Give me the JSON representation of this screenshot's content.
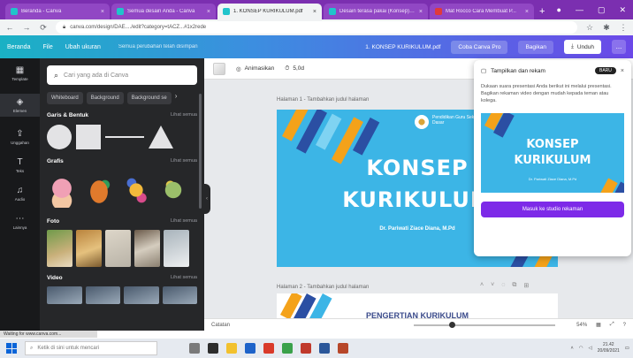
{
  "browser": {
    "tabs": [
      {
        "label": "Beranda - Canva",
        "active": false
      },
      {
        "label": "Semua desain Anda - Canva",
        "active": false
      },
      {
        "label": "1. KONSEP KURIKULUM.pdf",
        "active": true
      },
      {
        "label": "Desain terasa pakai (Konsep) - Canva",
        "active": false
      },
      {
        "label": "Mat Rocco Cara Membuat P...",
        "active": false
      }
    ],
    "url": "canva.com/design/DAE..../edit?category=tACZ...#1x2rede"
  },
  "canva_header": {
    "home": "Beranda",
    "file": "File",
    "resize": "Ubah ukuran",
    "saved_status": "Semua perubahan telah disimpan",
    "doc_title": "1. KONSEP KURIKULUM.pdf",
    "pro_button": "Coba Canva Pro",
    "share_button": "Bagikan",
    "download_button": "Unduh",
    "more": "..."
  },
  "rail": [
    {
      "label": "Template",
      "icon": "template-icon"
    },
    {
      "label": "Elemen",
      "icon": "elements-icon"
    },
    {
      "label": "Unggahan",
      "icon": "upload-icon"
    },
    {
      "label": "Teks",
      "icon": "text-icon"
    },
    {
      "label": "Audio",
      "icon": "audio-icon"
    },
    {
      "label": "Lainnya",
      "icon": "more-icon"
    }
  ],
  "panel": {
    "search_placeholder": "Cari yang ada di Canva",
    "chips": [
      "Whiteboard",
      "Background",
      "Background se"
    ],
    "sections": {
      "shapes": {
        "title": "Garis & Bentuk",
        "see_all": "Lihat semua"
      },
      "graphics": {
        "title": "Grafis",
        "see_all": "Lihat semua"
      },
      "photos": {
        "title": "Foto",
        "see_all": "Lihat semua"
      },
      "videos": {
        "title": "Video",
        "see_all": "Lihat semua"
      }
    }
  },
  "workspace": {
    "toolbar": {
      "animate": "Animasikan",
      "duration": "5,0d"
    },
    "page1_label": "Halaman 1 - Tambahkan judul halaman",
    "page2_label": "Halaman 2 - Tambahkan judul halaman",
    "slide1": {
      "institution": "Pendidikan Guru Sekolah Dasar",
      "title_line1": "KONSEP",
      "title_line2": "KURIKULUM",
      "author": "Dr. Pariwati Ziace Diana, M.Pd"
    },
    "slide2": {
      "heading": "PENGERTIAN KURIKULUM"
    }
  },
  "popover": {
    "title": "Tampilkan dan rekam",
    "badge": "BARU",
    "body": "Dukaan suara presentasi Anda berikut ini melalui presentasi. Bagikan rekaman video dengan mudah kepada teman atau kolega.",
    "preview_title1": "KONSEP",
    "preview_title2": "KURIKULUM",
    "preview_author": "Dr. Pariwati Ziace Diana, M.Pd",
    "cta": "Masuk ke studio rekaman"
  },
  "zoombar": {
    "notes": "Catatan",
    "zoom": "54%"
  },
  "status": "Waiting for www.canva.com...",
  "taskbar": {
    "search_placeholder": "Ketik di sini untuk mencari",
    "time": "21.42",
    "date": "20/09/2021"
  },
  "colors": {
    "canva_purple": "#7d2ae8",
    "slide_blue": "#3cb5e6",
    "stripe_orange": "#f4a21a",
    "stripe_navy": "#2b4fa3"
  }
}
